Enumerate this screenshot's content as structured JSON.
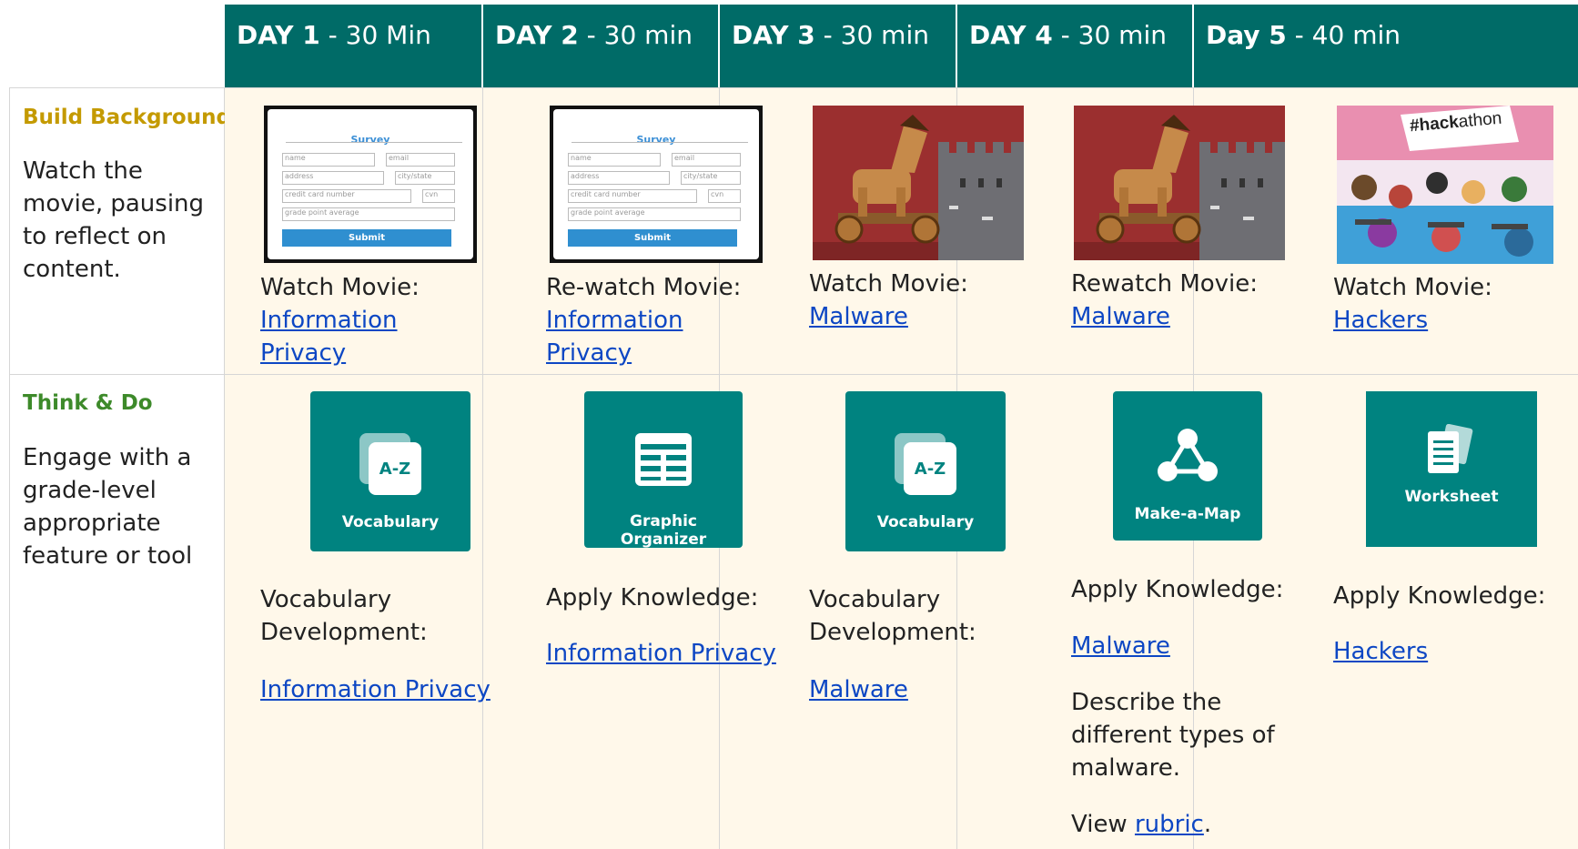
{
  "days": [
    {
      "day": "DAY 1",
      "duration": " - 30 Min"
    },
    {
      "day": "DAY 2",
      "duration": " - 30 min"
    },
    {
      "day": "DAY 3",
      "duration": " - 30 min"
    },
    {
      "day": "DAY 4",
      "duration": " - 30 min"
    },
    {
      "day": "Day 5",
      "duration": " - 40 min"
    }
  ],
  "rows": {
    "build": {
      "title": "Build Background",
      "description": "Watch the movie, pausing to reflect on content.",
      "cells": [
        {
          "prefix": "Watch Movie:",
          "link": "Information Privacy",
          "thumb": "survey-form"
        },
        {
          "prefix": "Re-watch Movie:",
          "link": "Information Privacy",
          "thumb": "survey-form"
        },
        {
          "prefix": "Watch Movie:",
          "link": "Malware",
          "thumb": "trojan-horse"
        },
        {
          "prefix": "Rewatch Movie:",
          "link": "Malware",
          "thumb": "trojan-horse"
        },
        {
          "prefix": "Watch Movie:",
          "link": "Hackers",
          "thumb": "hackathon"
        }
      ]
    },
    "think": {
      "title": "Think & Do",
      "description": "Engage with a grade-level appropriate feature or tool",
      "cells": [
        {
          "tool": "Vocabulary",
          "icon": "az-cards-icon",
          "prefix": "Vocabulary Development:",
          "link": "Information Privacy"
        },
        {
          "tool": "Graphic Organizer",
          "icon": "table-icon",
          "prefix": "Apply Knowledge:",
          "link": "Information Privacy"
        },
        {
          "tool": "Vocabulary",
          "icon": "az-cards-icon",
          "prefix": "Vocabulary Development:",
          "link": "Malware"
        },
        {
          "tool": "Make-a-Map",
          "icon": "network-icon",
          "prefix": "Apply Knowledge:",
          "link": "Malware",
          "extra": "Describe the different types of malware.",
          "view_prefix": "View ",
          "view_link": "rubric",
          "view_suffix": "."
        },
        {
          "tool": "Worksheet",
          "icon": "document-icon",
          "prefix": "Apply Knowledge:",
          "link": "Hackers"
        }
      ]
    }
  },
  "thumbs": {
    "survey": {
      "title": "Survey",
      "fields": [
        "name",
        "email",
        "address",
        "city/state",
        "credit card number",
        "cvn",
        "grade point average"
      ],
      "submit": "Submit"
    },
    "hackathon": {
      "sign": "#hackathon",
      "sign_bold": "#hack",
      "sign_light": "athon"
    }
  },
  "colors": {
    "header_bg": "#006b67",
    "cell_bg": "#fff8ea",
    "tool_bg": "#008380",
    "link": "#0d47c4",
    "gold": "#c49a00",
    "green": "#3d8a2a"
  }
}
